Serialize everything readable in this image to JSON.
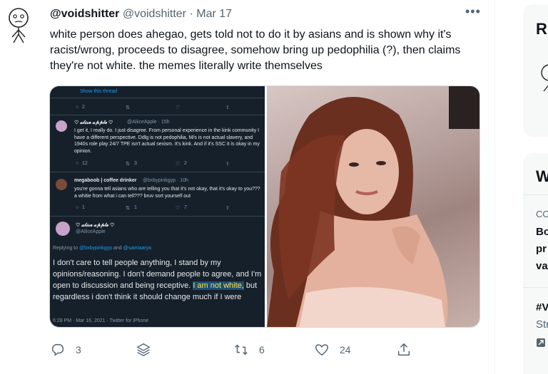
{
  "tweet": {
    "display_name": "@voidshitter",
    "handle": "@voidshitter",
    "separator": "·",
    "date": "Mar 17",
    "more_label": "•••",
    "text": "white person does ahegao, gets told not to do it by asians and is shown why it's racist/wrong, proceeds to disagree, somehow bring up pedophilia (?), then claims they're not white. the memes literally write themselves"
  },
  "screenshot": {
    "show_thread": "Show this thread",
    "top_counts": [
      "2",
      "",
      "",
      ""
    ],
    "reply1": {
      "name": "♡ 𝓪𝓵𝓲𝓬𝓮 𝓪𝓹𝓹𝓵𝓮 ♡",
      "handle": "@AliiceApple · 15h",
      "text": "I get it, I really do. I just disagree. From personal experience in the kink community I have a different perspective. Ddlg is not pedophilia, M/s is not actual slavery, and 1940s role play 24/7 TPE isn't actual sexism. It's kink. And if it's SSC it is okay in my opinion.",
      "counts": [
        "12",
        "3",
        "2",
        ""
      ]
    },
    "reply2": {
      "name": "megaboob | coffee drinker",
      "handle": "@bxbypinkgyp · 10h",
      "text": "you're gonna tell asians who are telling you that it's not okay, that it's okay to you??? a whitie from what i can tell??? bruv sort yourself out",
      "counts": [
        "1",
        "1",
        "7",
        ""
      ]
    },
    "reply3": {
      "name": "♡ 𝓪𝓵𝓲𝓬𝓮 𝓪𝓹𝓹𝓵𝓮 ♡",
      "handle": "@AliiceApple",
      "replying_prefix": "Replying to",
      "replying_to_1": "@bxbypinkgyp",
      "replying_and": "and",
      "replying_to_2": "@saintaarya",
      "text_before": "I don't care to tell people anything, I stand by my opinions/reasoning. I don't demand people to agree, and I'm open to discussion and being receptive.",
      "text_highlight": "I am not white,",
      "text_after": "but regardless i don't think it should change much if I were",
      "meta": "6:28 PM · Mar 16, 2021 · Twitter for iPhone"
    }
  },
  "actions": {
    "reply_count": "3",
    "retweet_count": "6",
    "like_count": "24"
  },
  "sidebar": {
    "card1_initial": "R",
    "card2_initial": "W",
    "trend_prefix": "CO",
    "trend_line1": "Bo",
    "trend_line2": "pr",
    "trend_line3": "va",
    "trend2_line1": "#V",
    "trend2_line2": "Str"
  },
  "colors": {
    "accent": "#1d9bf0",
    "text_primary": "#0f1419",
    "text_secondary": "#536471",
    "screenshot_bg": "#15202b",
    "highlight_bg": "#1d4f73",
    "highlight_text": "#ffe14d"
  }
}
